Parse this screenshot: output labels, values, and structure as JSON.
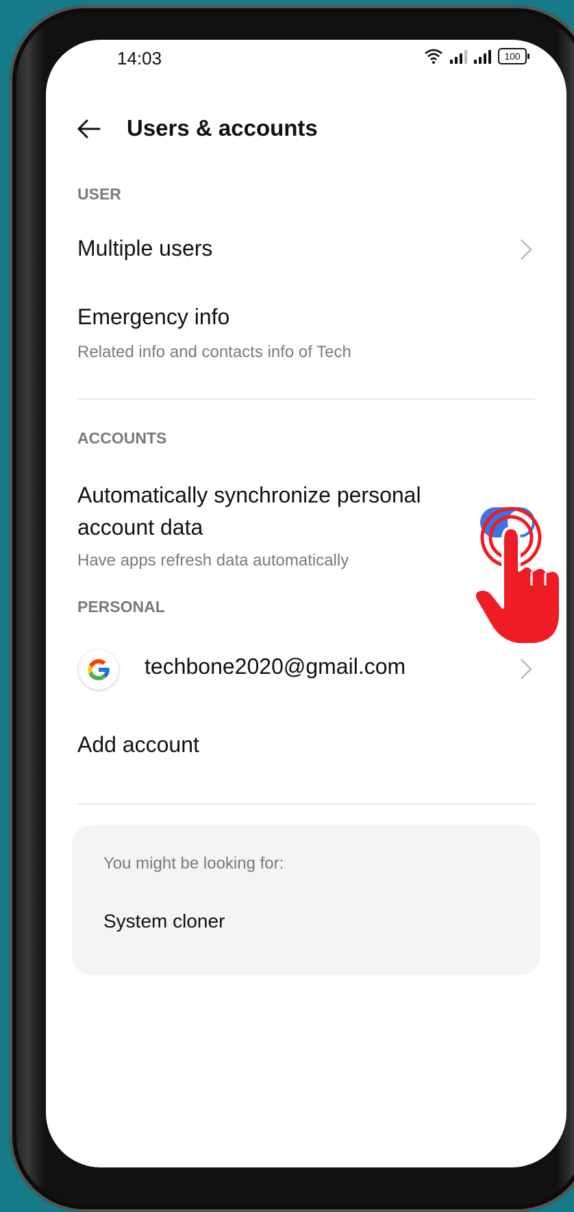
{
  "status_bar": {
    "time": "14:03",
    "battery": "100"
  },
  "header": {
    "title": "Users & accounts"
  },
  "sections": {
    "user": {
      "label": "USER",
      "multiple_users": "Multiple users",
      "emergency_title": "Emergency info",
      "emergency_sub": "Related info and contacts info of Tech"
    },
    "accounts": {
      "label": "ACCOUNTS",
      "sync_title_line1": "Automatically synchronize personal",
      "sync_title_line2": "account data",
      "sync_sub": "Have apps refresh data automatically",
      "sync_enabled": true
    },
    "personal": {
      "label": "PERSONAL",
      "google_account": "techbone2020@gmail.com",
      "add_account": "Add account"
    }
  },
  "suggestions": {
    "label": "You might be looking for:",
    "item": "System cloner"
  },
  "colors": {
    "accent": "#3b74e0",
    "overlay_hand": "#ee1c24",
    "background": "#167a88"
  },
  "icons": [
    "back-arrow-icon",
    "wifi-icon",
    "signal-icon",
    "battery-icon",
    "chevron-right-icon",
    "google-logo-icon",
    "tap-hand-icon"
  ]
}
